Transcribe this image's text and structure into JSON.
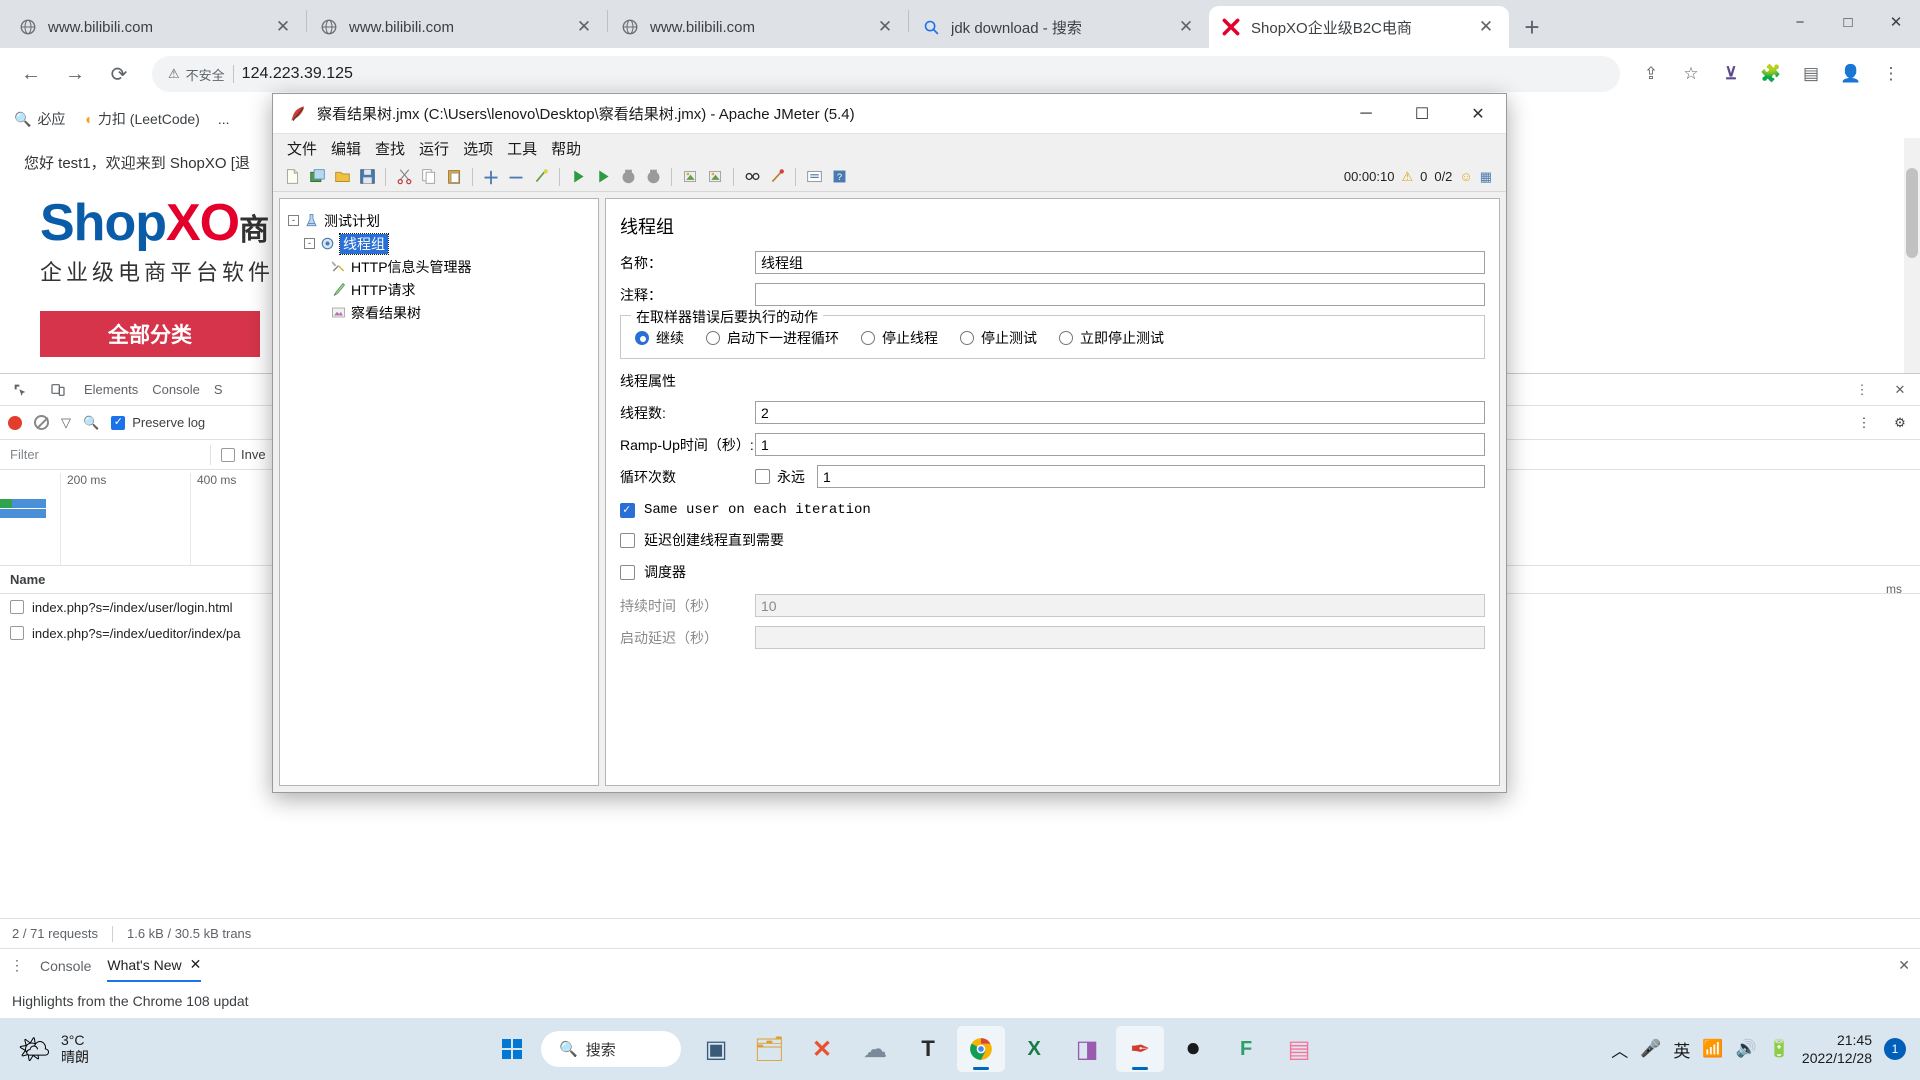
{
  "browser": {
    "tabs": [
      {
        "title": "www.bilibili.com",
        "icon": "globe-icon",
        "active": false
      },
      {
        "title": "www.bilibili.com",
        "icon": "globe-icon",
        "active": false
      },
      {
        "title": "www.bilibili.com",
        "icon": "globe-icon",
        "active": false
      },
      {
        "title": "jdk download - 搜索",
        "icon": "search-icon",
        "active": false
      },
      {
        "title": "ShopXO企业级B2C电商",
        "icon": "shopxo-icon",
        "active": true
      }
    ],
    "newtab_label": "+",
    "window_controls": {
      "minimize": "−",
      "maximize": "□",
      "close": "✕"
    },
    "nav": {
      "back": "←",
      "forward": "→",
      "reload": "⟳"
    },
    "url": {
      "warning_icon": "warning-triangle-icon",
      "warning_text": "不安全",
      "address": "124.223.39.125"
    },
    "omni_actions": {
      "share": "share-icon",
      "bookmark": "star-icon",
      "ext1": "extension-icon",
      "ext2": "puzzle-icon",
      "sidepanel": "side-panel-icon",
      "profile": "profile-icon",
      "menu": "more-menu-icon"
    },
    "bookmarks": [
      {
        "label": "必应",
        "icon": "search-icon"
      },
      {
        "label": "力扣 (LeetCode)",
        "icon": "leetcode-icon"
      },
      {
        "label": "...",
        "icon": "overflow-icon"
      }
    ]
  },
  "page": {
    "greeting": "您好 test1，欢迎来到 ShopXO [退",
    "logo_main": "ShopXO",
    "logo_main_red": "XO",
    "logo_suffix": "商",
    "logo_sub": "企业级电商平台软件解决",
    "category_button": "全部分类"
  },
  "devtools": {
    "tabs": [
      "Elements",
      "Console",
      "S"
    ],
    "icons": {
      "inspect": "inspect-icon",
      "device": "device-toolbar-icon",
      "more": "more-vertical-icon",
      "close": "close-icon",
      "settings": "gear-icon"
    },
    "toolbar": {
      "record_icon": "record-icon",
      "clear_icon": "clear-icon",
      "filter_icon": "filter-icon",
      "search_icon": "search-icon",
      "preserve_log": "Preserve log",
      "preserve_log_checked": true
    },
    "filter": {
      "placeholder": "Filter",
      "invert_label": "Inve",
      "invert_checked": false
    },
    "timeline": {
      "ticks": [
        "200 ms",
        "400 ms"
      ],
      "right_tick": "ms"
    },
    "table": {
      "header": "Name",
      "rows": [
        {
          "name": "index.php?s=/index/user/login.html"
        },
        {
          "name": "index.php?s=/index/ueditor/index/pa"
        }
      ]
    },
    "status": {
      "requests": "2 / 71 requests",
      "transferred": "1.6 kB / 30.5 kB trans"
    },
    "drawer": {
      "tabs": [
        "Console",
        "What's New"
      ],
      "selected": "What's New",
      "close_icon": "close-icon",
      "menu_icon": "more-vertical-icon",
      "body_text": "Highlights from the Chrome 108 updat"
    }
  },
  "jmeter": {
    "title": "察看结果树.jmx (C:\\Users\\lenovo\\Desktop\\察看结果树.jmx) - Apache JMeter (5.4)",
    "title_icon": "jmeter-feather-icon",
    "window_controls": {
      "minimize": "─",
      "maximize": "☐",
      "close": "✕"
    },
    "menus": [
      "文件",
      "编辑",
      "查找",
      "运行",
      "选项",
      "工具",
      "帮助"
    ],
    "toolbar_icons": [
      "new-icon",
      "templates-icon",
      "open-icon",
      "save-icon",
      "sep",
      "cut-icon",
      "copy-icon",
      "paste-icon",
      "sep",
      "expand-icon",
      "collapse-icon",
      "toggle-icon",
      "sep",
      "start-icon",
      "start-no-timers-icon",
      "stop-icon",
      "shutdown-icon",
      "sep",
      "clear-icon",
      "clear-all-icon",
      "sep",
      "search-icon",
      "search-reset-icon",
      "sep",
      "function-helper-icon",
      "help-icon"
    ],
    "status": {
      "elapsed": "00:00:10",
      "warn_icon": "warning-triangle-icon",
      "warn_count": "0",
      "threads": "0/2",
      "face_icon": "smile-icon",
      "conn_icon": "connections-icon"
    },
    "tree": [
      {
        "label": "测试计划",
        "icon": "test-plan-icon",
        "indent": 0,
        "toggle": "-",
        "selected": false
      },
      {
        "label": "线程组",
        "icon": "thread-group-icon",
        "indent": 1,
        "toggle": "-",
        "selected": true
      },
      {
        "label": "HTTP信息头管理器",
        "icon": "header-manager-icon",
        "indent": 2,
        "toggle": "",
        "selected": false
      },
      {
        "label": "HTTP请求",
        "icon": "http-request-icon",
        "indent": 2,
        "toggle": "",
        "selected": false
      },
      {
        "label": "察看结果树",
        "icon": "view-results-tree-icon",
        "indent": 2,
        "toggle": "",
        "selected": false
      }
    ],
    "panel": {
      "title": "线程组",
      "name_label": "名称：",
      "name_value": "线程组",
      "comment_label": "注释：",
      "comment_value": "",
      "error_action": {
        "legend": "在取样器错误后要执行的动作",
        "options": [
          {
            "label": "继续",
            "selected": true
          },
          {
            "label": "启动下一进程循环",
            "selected": false
          },
          {
            "label": "停止线程",
            "selected": false
          },
          {
            "label": "停止测试",
            "selected": false
          },
          {
            "label": "立即停止测试",
            "selected": false
          }
        ]
      },
      "thread_props_heading": "线程属性",
      "fields": [
        {
          "label": "线程数:",
          "value": "2",
          "disabled": false
        },
        {
          "label": "Ramp-Up时间（秒）:",
          "value": "1",
          "disabled": false
        }
      ],
      "loop": {
        "label": "循环次数",
        "forever_label": "永远",
        "forever_checked": false,
        "value": "1"
      },
      "checks": [
        {
          "label": "Same user on each iteration",
          "checked": true,
          "mono": true,
          "disabled": false
        },
        {
          "label": "延迟创建线程直到需要",
          "checked": false,
          "mono": false,
          "disabled": false
        },
        {
          "label": "调度器",
          "checked": false,
          "mono": false,
          "disabled": false
        }
      ],
      "scheduler_fields": [
        {
          "label": "持续时间（秒）",
          "value": "10",
          "disabled": true
        },
        {
          "label": "启动延迟（秒）",
          "value": "",
          "disabled": true
        }
      ]
    }
  },
  "taskbar": {
    "weather": {
      "temp": "3°C",
      "desc": "晴朗",
      "icon": "sun-icon"
    },
    "start_icon": "windows-start-icon",
    "search": {
      "label": "搜索",
      "icon": "search-icon"
    },
    "apps": [
      {
        "name": "task-view-icon",
        "glyph": "▣",
        "active": false
      },
      {
        "name": "file-explorer-icon",
        "glyph": "🗂",
        "active": false
      },
      {
        "name": "wechat-icon",
        "glyph": "✕",
        "active": false
      },
      {
        "name": "cloud-app-icon",
        "glyph": "☁",
        "active": false
      },
      {
        "name": "typora-icon",
        "glyph": "T",
        "active": false
      },
      {
        "name": "chrome-icon",
        "glyph": "●",
        "active": true
      },
      {
        "name": "excel-icon",
        "glyph": "X",
        "active": false
      },
      {
        "name": "photos-icon",
        "glyph": "◩",
        "active": false
      },
      {
        "name": "jmeter-icon",
        "glyph": "✐",
        "active": true
      },
      {
        "name": "record-app-icon",
        "glyph": "●",
        "active": false
      },
      {
        "name": "feishu-icon",
        "glyph": "F",
        "active": false
      },
      {
        "name": "bilibili-icon",
        "glyph": "■",
        "active": false
      }
    ],
    "tray": {
      "chevron": "show-hidden-icons",
      "mic": "microphone-icon",
      "ime": "英",
      "wifi": "wifi-icon",
      "volume": "volume-icon",
      "battery": "battery-icon"
    },
    "clock": {
      "time": "21:45",
      "date": "2022/12/28"
    },
    "notification_count": "1"
  }
}
